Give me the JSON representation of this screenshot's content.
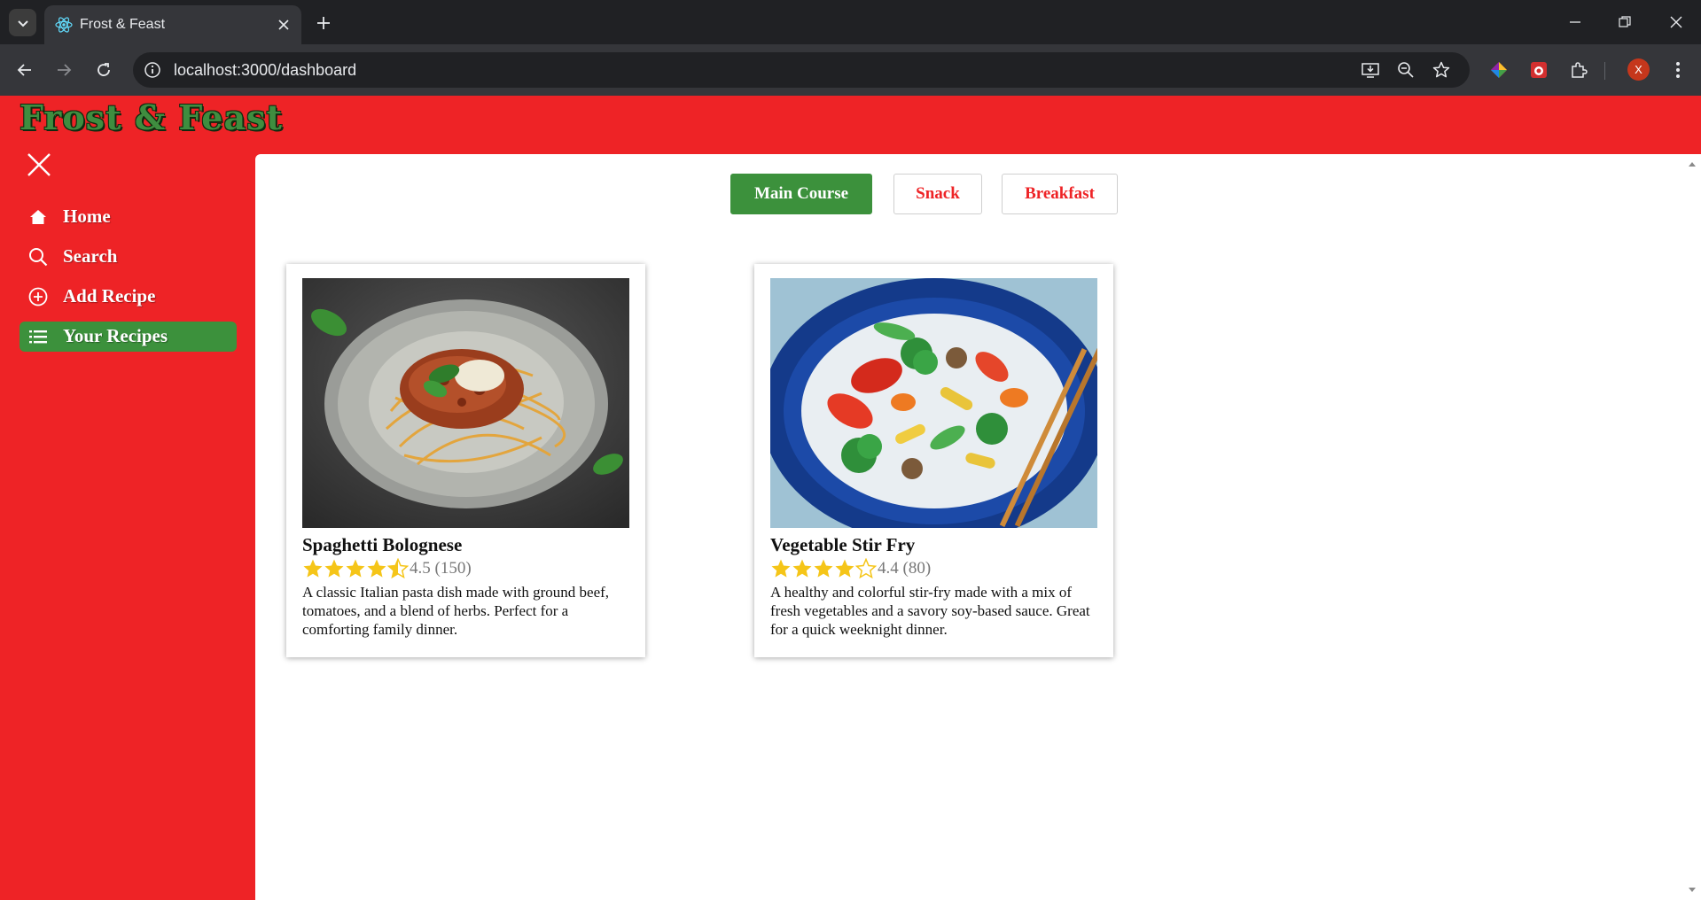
{
  "browser": {
    "tab_title": "Frost & Feast",
    "url": "localhost:3000/dashboard",
    "profile_initial": "X"
  },
  "app": {
    "brand": "Frost & Feast",
    "nav": [
      {
        "label": "Home",
        "icon": "home-icon"
      },
      {
        "label": "Search",
        "icon": "search-icon"
      },
      {
        "label": "Add Recipe",
        "icon": "add-circle-icon"
      },
      {
        "label": "Your Recipes",
        "icon": "list-icon",
        "active": true
      }
    ],
    "categories": [
      {
        "label": "Main Course",
        "active": true
      },
      {
        "label": "Snack",
        "active": false
      },
      {
        "label": "Breakfast",
        "active": false
      }
    ],
    "recipes": [
      {
        "title": "Spaghetti Bolognese",
        "rating": 4.5,
        "rating_text": "4.5 (150)",
        "description": "A classic Italian pasta dish made with ground beef, tomatoes, and a blend of herbs. Perfect for a comforting family dinner."
      },
      {
        "title": "Vegetable Stir Fry",
        "rating": 4.4,
        "rating_text": "4.4 (80)",
        "description": "A healthy and colorful stir-fry made with a mix of fresh vegetables and a savory soy-based sauce. Great for a quick weeknight dinner."
      }
    ]
  },
  "colors": {
    "primary_red": "#ee2326",
    "accent_green": "#3c913c",
    "star_gold": "#f5c518"
  }
}
